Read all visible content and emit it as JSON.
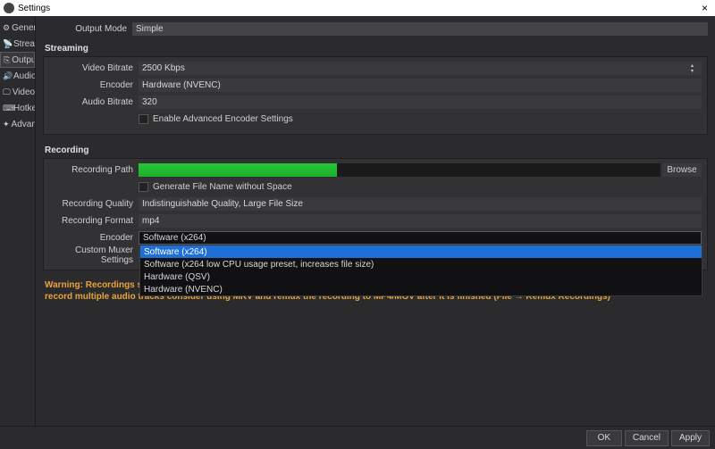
{
  "window": {
    "title": "Settings"
  },
  "sidebar": {
    "items": [
      {
        "icon": "⚙",
        "label": "General"
      },
      {
        "icon": "📡",
        "label": "Stream"
      },
      {
        "icon": "⎘",
        "label": "Output"
      },
      {
        "icon": "🔊",
        "label": "Audio"
      },
      {
        "icon": "🖵",
        "label": "Video"
      },
      {
        "icon": "⌨",
        "label": "Hotkeys"
      },
      {
        "icon": "✦",
        "label": "Advanced"
      }
    ]
  },
  "output_mode": {
    "label": "Output Mode",
    "value": "Simple"
  },
  "streaming": {
    "header": "Streaming",
    "video_bitrate": {
      "label": "Video Bitrate",
      "value": "2500 Kbps"
    },
    "encoder": {
      "label": "Encoder",
      "value": "Hardware (NVENC)"
    },
    "audio_bitrate": {
      "label": "Audio Bitrate",
      "value": "320"
    },
    "adv_checkbox": "Enable Advanced Encoder Settings"
  },
  "recording": {
    "header": "Recording",
    "path": {
      "label": "Recording Path",
      "browse": "Browse"
    },
    "gen_filename": "Generate File Name without Space",
    "quality": {
      "label": "Recording Quality",
      "value": "Indistinguishable Quality, Large File Size"
    },
    "format": {
      "label": "Recording Format",
      "value": "mp4"
    },
    "encoder": {
      "label": "Encoder",
      "value": "Software (x264)"
    },
    "encoder_options": [
      "Software (x264)",
      "Software (x264 low CPU usage preset, increases file size)",
      "Hardware (QSV)",
      "Hardware (NVENC)"
    ],
    "muxer": {
      "label": "Custom Muxer Settings"
    }
  },
  "warning_text": "Warning: Recordings saved to MP4/MOV will be unrecoverable if the file cannot be finalized (e.g. as a result of BSoDs, power losses, etc.). If you want to record multiple audio tracks consider using MKV and remux the recording to MP4/MOV after it is finished (File → Remux Recordings)",
  "footer": {
    "ok": "OK",
    "cancel": "Cancel",
    "apply": "Apply"
  }
}
